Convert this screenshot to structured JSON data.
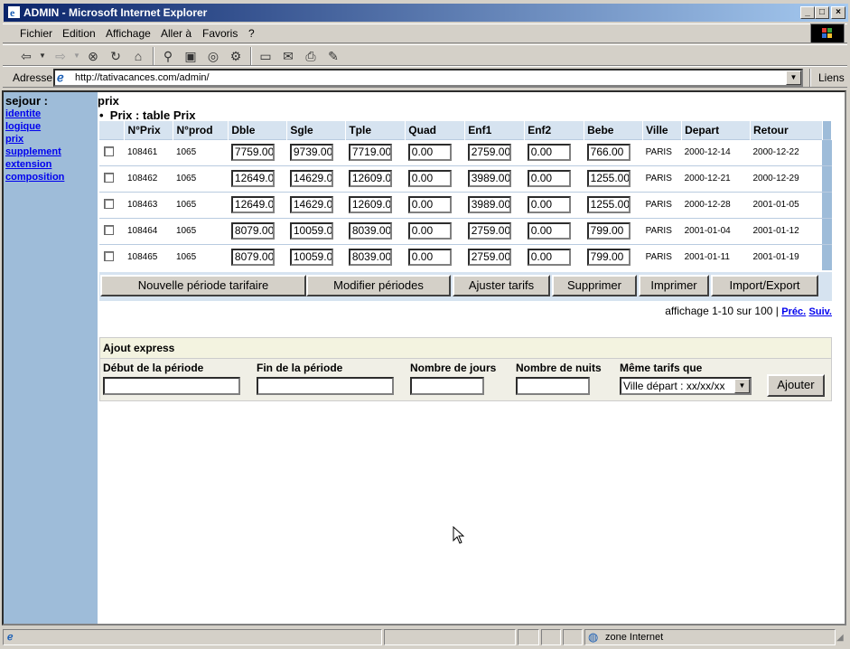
{
  "window": {
    "title": "ADMIN - Microsoft Internet Explorer"
  },
  "menu": [
    {
      "label": "Fichier"
    },
    {
      "label": "Edition"
    },
    {
      "label": "Affichage"
    },
    {
      "label": "Aller à"
    },
    {
      "label": "Favoris"
    },
    {
      "label": "?"
    }
  ],
  "address": {
    "label": "Adresse",
    "url": "http://tativacances.com/admin/",
    "links_label": "Liens"
  },
  "sidebar": {
    "title": "sejour :",
    "items": [
      {
        "label": "identite"
      },
      {
        "label": "logique"
      },
      {
        "label": "prix"
      },
      {
        "label": "supplement"
      },
      {
        "label": "extension"
      },
      {
        "label": "composition"
      }
    ]
  },
  "main": {
    "heading": "prix",
    "bullet": "Prix : table Prix"
  },
  "table": {
    "headers": [
      "",
      "N°Prix",
      "N°prod",
      "Dble",
      "Sgle",
      "Tple",
      "Quad",
      "Enf1",
      "Enf2",
      "Bebe",
      "Ville",
      "Depart",
      "Retour"
    ],
    "rows": [
      {
        "nprix": "108461",
        "nprod": "1065",
        "dble": "7759.00",
        "sgle": "9739.00",
        "tple": "7719.00",
        "quad": "0.00",
        "enf1": "2759.00",
        "enf2": "0.00",
        "bebe": "766.00",
        "ville": "PARIS",
        "depart": "2000-12-14",
        "retour": "2000-12-22"
      },
      {
        "nprix": "108462",
        "nprod": "1065",
        "dble": "12649.00",
        "sgle": "14629.00",
        "tple": "12609.00",
        "quad": "0.00",
        "enf1": "3989.00",
        "enf2": "0.00",
        "bebe": "1255.00",
        "ville": "PARIS",
        "depart": "2000-12-21",
        "retour": "2000-12-29"
      },
      {
        "nprix": "108463",
        "nprod": "1065",
        "dble": "12649.00",
        "sgle": "14629.00",
        "tple": "12609.00",
        "quad": "0.00",
        "enf1": "3989.00",
        "enf2": "0.00",
        "bebe": "1255.00",
        "ville": "PARIS",
        "depart": "2000-12-28",
        "retour": "2001-01-05"
      },
      {
        "nprix": "108464",
        "nprod": "1065",
        "dble": "8079.00",
        "sgle": "10059.00",
        "tple": "8039.00",
        "quad": "0.00",
        "enf1": "2759.00",
        "enf2": "0.00",
        "bebe": "799.00",
        "ville": "PARIS",
        "depart": "2001-01-04",
        "retour": "2001-01-12"
      },
      {
        "nprix": "108465",
        "nprod": "1065",
        "dble": "8079.00",
        "sgle": "10059.00",
        "tple": "8039.00",
        "quad": "0.00",
        "enf1": "2759.00",
        "enf2": "0.00",
        "bebe": "799.00",
        "ville": "PARIS",
        "depart": "2001-01-11",
        "retour": "2001-01-19"
      }
    ]
  },
  "actions": {
    "nouvelle": "Nouvelle période tarifaire",
    "modifier": "Modifier périodes",
    "ajuster": "Ajuster tarifs",
    "supprimer": "Supprimer",
    "imprimer": "Imprimer",
    "import": "Import/Export"
  },
  "pagination": {
    "text": "affichage 1-10 sur 100 |",
    "prev": "Préc.",
    "next": "Suiv."
  },
  "express": {
    "title": "Ajout express",
    "debut": "Début de la période",
    "fin": "Fin de la période",
    "jours": "Nombre de jours",
    "nuits": "Nombre de nuits",
    "meme": "Même tarifs que",
    "select_value": "Ville départ : xx/xx/xx",
    "submit": "Ajouter"
  },
  "status": {
    "zone": "zone Internet"
  }
}
